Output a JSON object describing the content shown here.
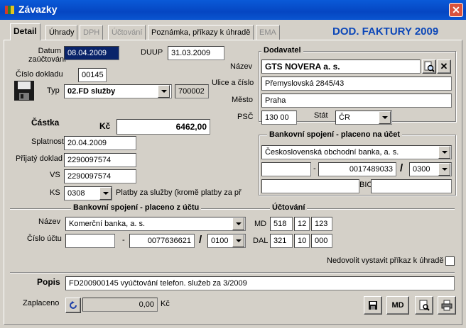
{
  "window": {
    "title": "Závazky"
  },
  "tabs": [
    {
      "label": "Detail"
    },
    {
      "label": "Úhrady"
    },
    {
      "label": "DPH"
    },
    {
      "label": "Účtování"
    },
    {
      "label": "Poznámka, příkazy k úhradě"
    },
    {
      "label": "EMA"
    }
  ],
  "doc_title": "DOD. FAKTURY 2009",
  "header": {
    "datum_label": "Datum zaúčtování",
    "datum_value": "08.04.2009",
    "duup_label": "DUUP",
    "duup_value": "31.03.2009",
    "cislo_label": "Číslo dokladu",
    "cislo_value": "00145",
    "typ_label": "Typ",
    "typ_value": "02.FD služby",
    "typ_code": "700002"
  },
  "amount": {
    "section_label": "Částka",
    "currency": "Kč",
    "value": "6462,00",
    "splatnost_label": "Splatnost",
    "splatnost_value": "20.04.2009",
    "prijaty_label": "Přijatý doklad",
    "prijaty_value": "2290097574",
    "vs_label": "VS",
    "vs_value": "2290097574",
    "ks_label": "KS",
    "ks_value": "0308",
    "ks_note": "Platby za služby (kromě platby za př"
  },
  "supplier": {
    "title": "Dodavatel",
    "nazev_label": "Název",
    "nazev_value": "GTS NOVERA a. s.",
    "ulice_label": "Ulice a číslo",
    "ulice_value": "Přemyslovská 2845/43",
    "mesto_label": "Město",
    "mesto_value": "Praha",
    "psc_label": "PSČ",
    "psc_value": "130 00",
    "stat_label": "Stát",
    "stat_value": "ČR",
    "bank_title": "Bankovní spojení - placeno na účet",
    "bank_name": "Československá obchodní banka, a. s.",
    "account_prefix": "",
    "account_number": "0017489033",
    "bank_code": "0300",
    "iban": "",
    "bic_label": "BIC",
    "bic_value": ""
  },
  "payer_bank": {
    "title": "Bankovní spojení - placeno z účtu",
    "nazev_label": "Název",
    "bank_name": "Komerční banka, a. s.",
    "cislo_label": "Číslo účtu",
    "account_prefix": "",
    "account_number": "0077636621",
    "bank_code": "0100"
  },
  "accounting": {
    "title": "Účtování",
    "md_label": "MD",
    "md": [
      "518",
      "12",
      "123"
    ],
    "dal_label": "DAL",
    "dal": [
      "321",
      "10",
      "000"
    ]
  },
  "nedovolit_label": "Nedovolit vystavit příkaz k úhradě",
  "popis_label": "Popis",
  "popis_value": "FD200900145  vyúčtování telefon. služeb  za 3/2009",
  "zaplaceno_label": "Zaplaceno",
  "zaplaceno_value": "0,00",
  "zaplaceno_currency": "Kč",
  "buttons": {
    "md_label": "MD"
  },
  "colors": {
    "titlebar": "#0a5ad8",
    "doc_title": "#0c47b8",
    "selection": "#0a246a"
  }
}
